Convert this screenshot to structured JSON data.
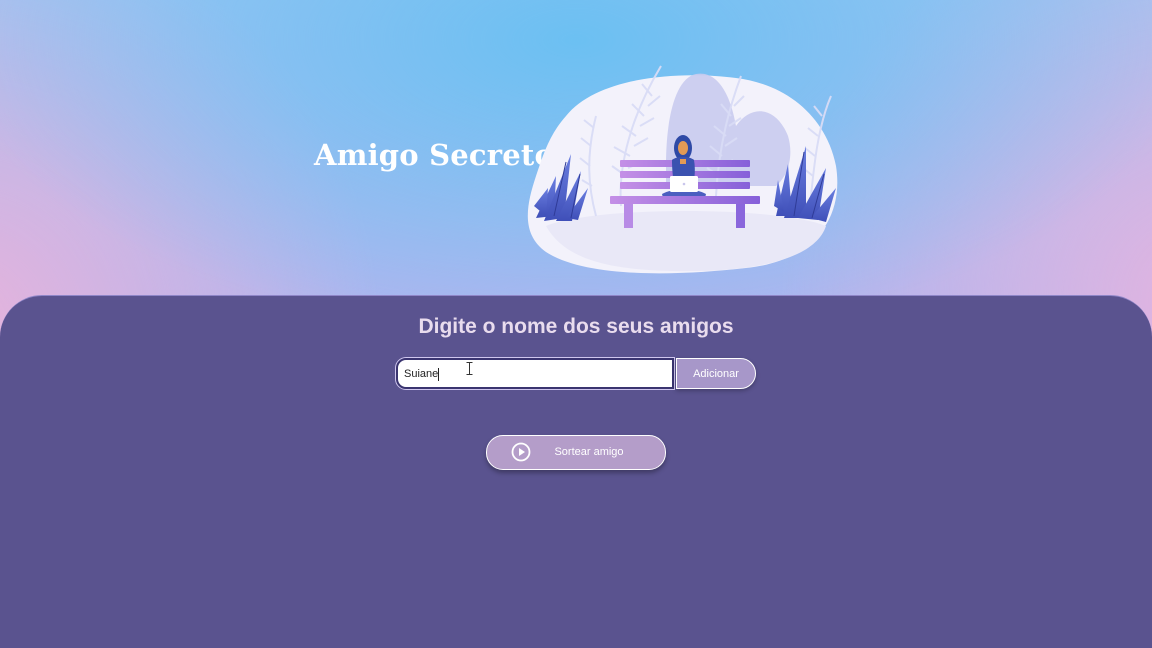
{
  "header": {
    "title": "Amigo Secreto",
    "illustration_icon": "person-on-bench-with-laptop-illustration"
  },
  "main": {
    "heading": "Digite o nome dos seus amigos",
    "friend_input": {
      "value": "Suiane",
      "placeholder": ""
    },
    "add_button_label": "Adicionar",
    "draw_button": {
      "label": "Sortear amigo",
      "icon": "play-circle-icon"
    },
    "friends": [],
    "result": []
  },
  "colors": {
    "panel_background": "#5a538f",
    "heading_text": "#e9dcee",
    "add_button": "#a797c9",
    "draw_button": "#b49dc9",
    "input_border": "#3a3470"
  }
}
